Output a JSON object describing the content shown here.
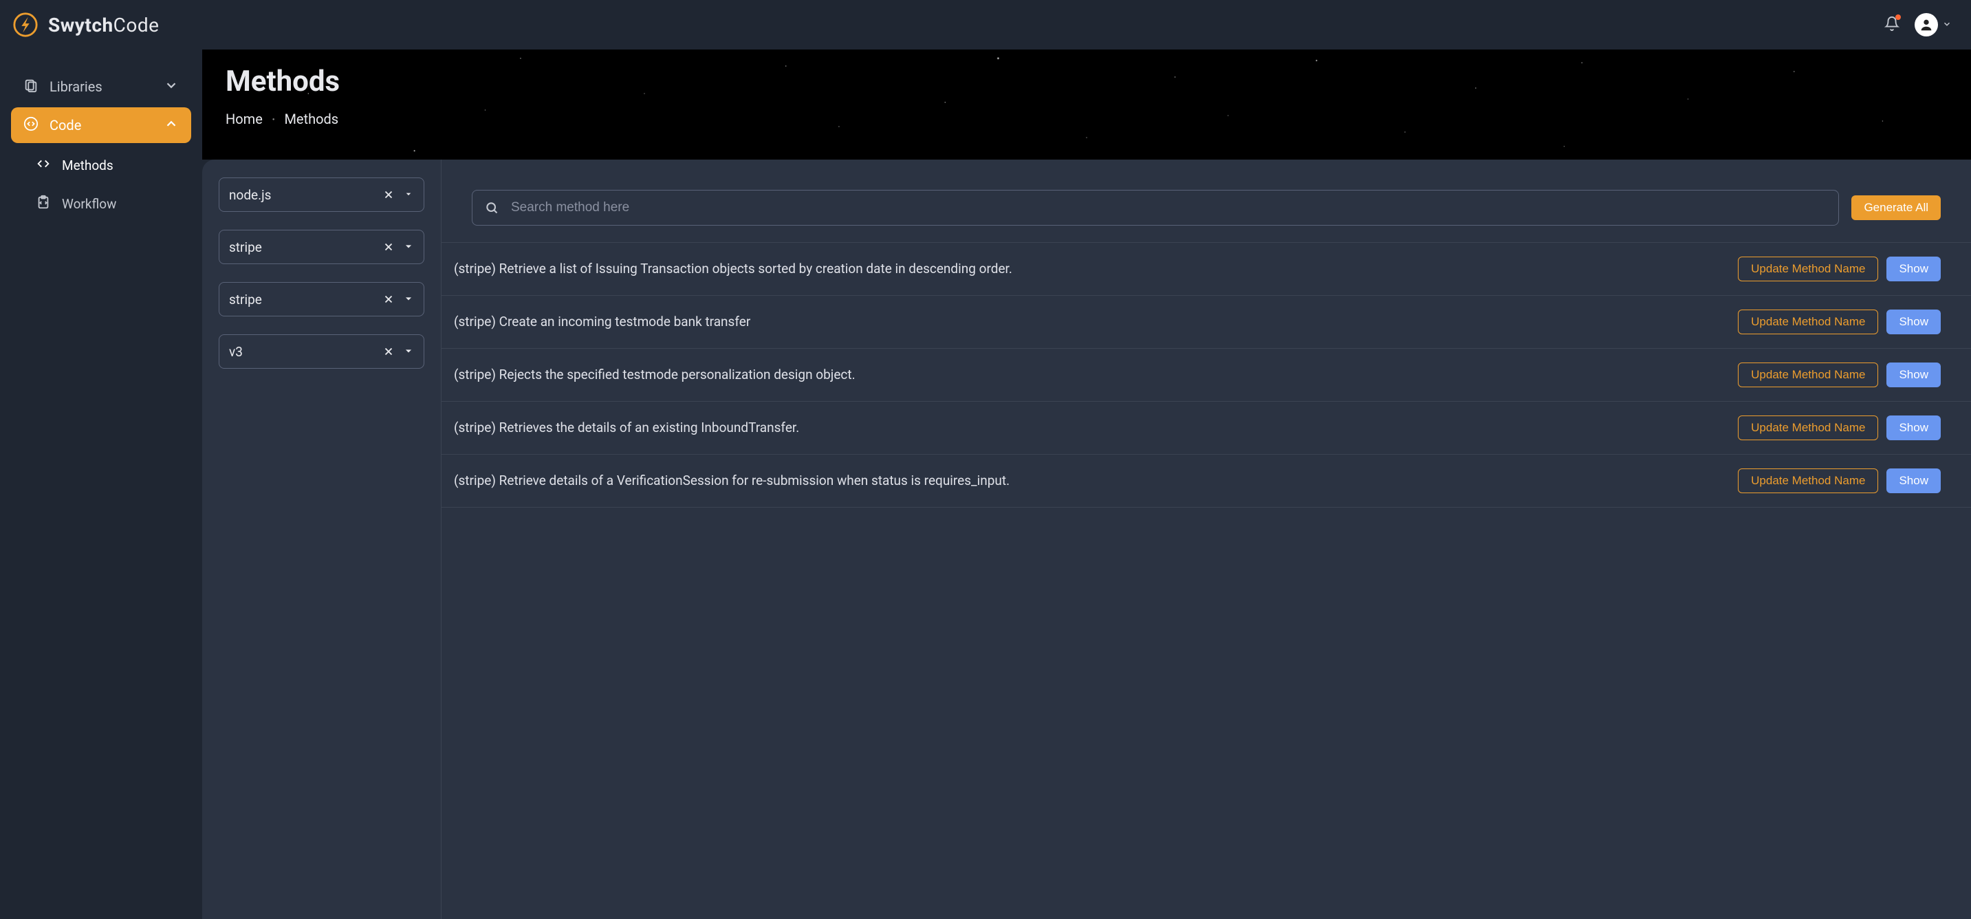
{
  "brand": {
    "strong": "Swytch",
    "light": "Code"
  },
  "sidebar": {
    "items": [
      {
        "label": "Libraries"
      },
      {
        "label": "Code"
      }
    ],
    "code_sub": [
      {
        "label": "Methods"
      },
      {
        "label": "Workflow"
      }
    ]
  },
  "page": {
    "title": "Methods",
    "breadcrumb": {
      "home": "Home",
      "current": "Methods"
    }
  },
  "filters": [
    {
      "value": "node.js"
    },
    {
      "value": "stripe"
    },
    {
      "value": "stripe"
    },
    {
      "value": "v3"
    }
  ],
  "search": {
    "placeholder": "Search method here"
  },
  "buttons": {
    "generate_all": "Generate All",
    "update": "Update Method Name",
    "show": "Show"
  },
  "methods": [
    {
      "desc": "(stripe) Retrieve a list of Issuing Transaction objects sorted by creation date in descending order."
    },
    {
      "desc": "(stripe) Create an incoming testmode bank transfer"
    },
    {
      "desc": "(stripe) Rejects the specified testmode personalization design object."
    },
    {
      "desc": "(stripe) Retrieves the details of an existing InboundTransfer."
    },
    {
      "desc": "(stripe) Retrieve details of a VerificationSession for re-submission when status is requires_input."
    }
  ]
}
